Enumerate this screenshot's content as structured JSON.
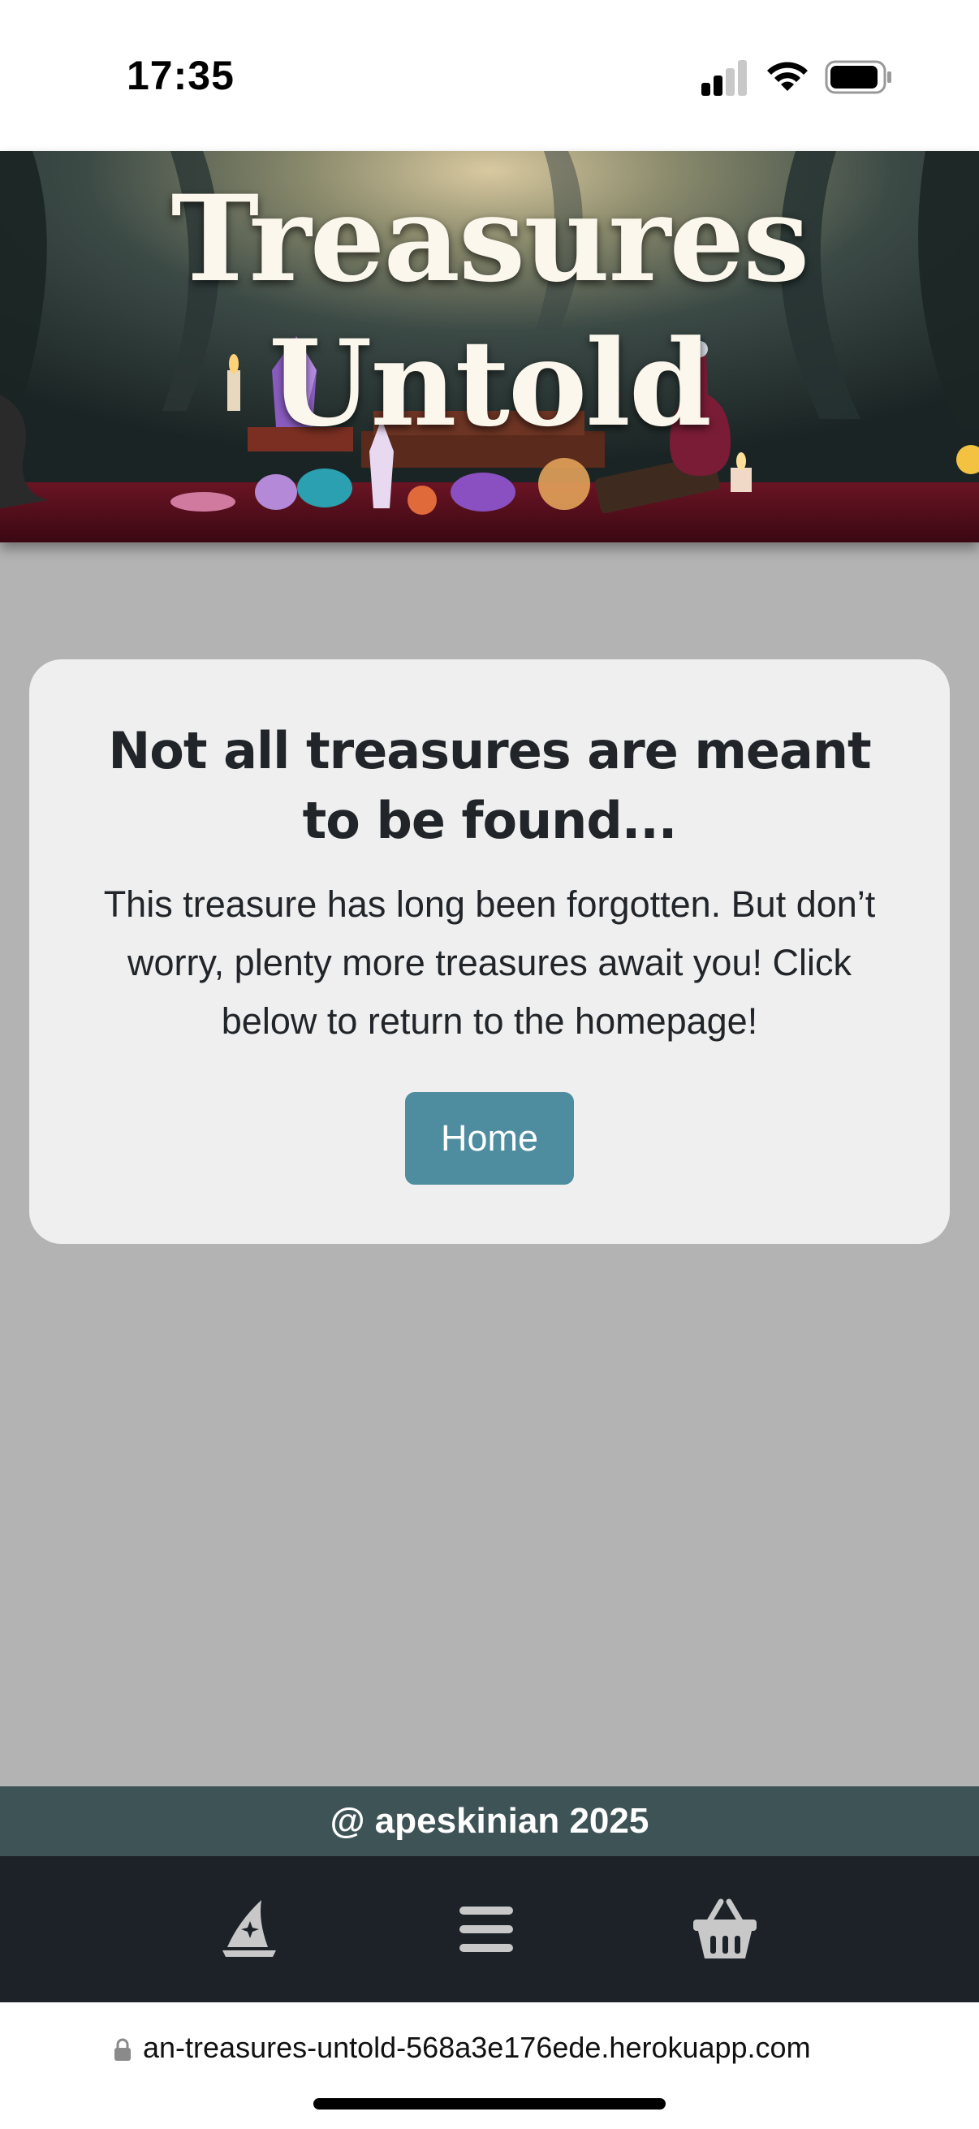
{
  "status_bar": {
    "time": "17:35",
    "icons": [
      "signal-icon",
      "wifi-icon",
      "battery-icon"
    ]
  },
  "hero": {
    "title_line1": "Treasures",
    "title_line2": "Untold"
  },
  "card": {
    "heading": "Not all treasures are meant to be found...",
    "text": "This treasure has long been forgotten. But don’t worry, plenty more treasures await you! Click below to return to the homepage!",
    "button_label": "Home",
    "button_color": "#4e8c9f"
  },
  "footer": {
    "text": "@ apeskinian 2025",
    "color": "#3d5355"
  },
  "bottom_nav": {
    "items": [
      "wizard-hat-icon",
      "menu-icon",
      "basket-icon"
    ]
  },
  "browser": {
    "url": "an-treasures-untold-568a3e176ede.herokuapp.com"
  }
}
